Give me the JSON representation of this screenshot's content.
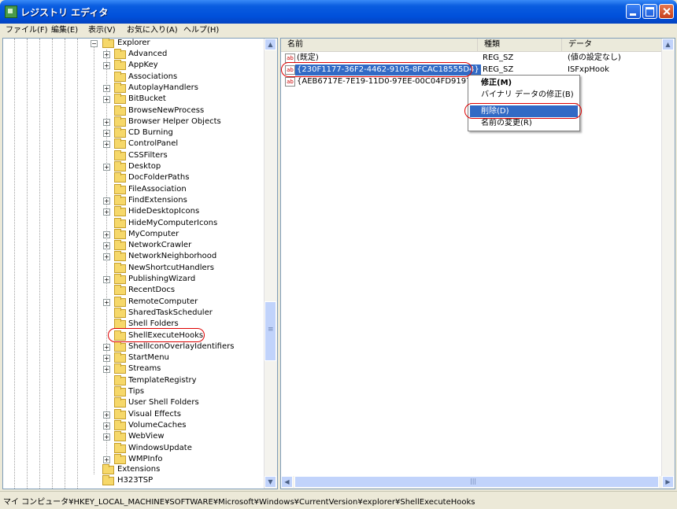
{
  "window": {
    "title": "レジストリ エディタ"
  },
  "menu": [
    {
      "label": "ファイル(F)"
    },
    {
      "label": "編集(E)"
    },
    {
      "label": "表示(V)"
    },
    {
      "label": "お気に入り(A)"
    },
    {
      "label": "ヘルプ(H)"
    }
  ],
  "tree": {
    "parent": "Explorer",
    "items": [
      {
        "label": "Advanced",
        "expandable": true
      },
      {
        "label": "AppKey",
        "expandable": true
      },
      {
        "label": "Associations",
        "expandable": false
      },
      {
        "label": "AutoplayHandlers",
        "expandable": true
      },
      {
        "label": "BitBucket",
        "expandable": true
      },
      {
        "label": "BrowseNewProcess",
        "expandable": false
      },
      {
        "label": "Browser Helper Objects",
        "expandable": true
      },
      {
        "label": "CD Burning",
        "expandable": true
      },
      {
        "label": "ControlPanel",
        "expandable": true
      },
      {
        "label": "CSSFilters",
        "expandable": false
      },
      {
        "label": "Desktop",
        "expandable": true
      },
      {
        "label": "DocFolderPaths",
        "expandable": false
      },
      {
        "label": "FileAssociation",
        "expandable": false
      },
      {
        "label": "FindExtensions",
        "expandable": true
      },
      {
        "label": "HideDesktopIcons",
        "expandable": true
      },
      {
        "label": "HideMyComputerIcons",
        "expandable": false
      },
      {
        "label": "MyComputer",
        "expandable": true
      },
      {
        "label": "NetworkCrawler",
        "expandable": true
      },
      {
        "label": "NetworkNeighborhood",
        "expandable": true
      },
      {
        "label": "NewShortcutHandlers",
        "expandable": false
      },
      {
        "label": "PublishingWizard",
        "expandable": true
      },
      {
        "label": "RecentDocs",
        "expandable": false
      },
      {
        "label": "RemoteComputer",
        "expandable": true
      },
      {
        "label": "SharedTaskScheduler",
        "expandable": false
      },
      {
        "label": "Shell Folders",
        "expandable": false
      },
      {
        "label": "ShellExecuteHooks",
        "expandable": false
      },
      {
        "label": "ShellIconOverlayIdentifiers",
        "expandable": true
      },
      {
        "label": "StartMenu",
        "expandable": true
      },
      {
        "label": "Streams",
        "expandable": true
      },
      {
        "label": "TemplateRegistry",
        "expandable": false
      },
      {
        "label": "Tips",
        "expandable": false
      },
      {
        "label": "User Shell Folders",
        "expandable": false
      },
      {
        "label": "Visual Effects",
        "expandable": true
      },
      {
        "label": "VolumeCaches",
        "expandable": true
      },
      {
        "label": "WebView",
        "expandable": true
      },
      {
        "label": "WindowsUpdate",
        "expandable": false
      },
      {
        "label": "WMPInfo",
        "expandable": true
      }
    ],
    "after": [
      {
        "label": "Extensions"
      },
      {
        "label": "H323TSP"
      }
    ]
  },
  "list": {
    "headers": {
      "name": "名前",
      "type": "種類",
      "data": "データ"
    },
    "rows": [
      {
        "name": "(既定)",
        "type": "REG_SZ",
        "data": "(値の設定なし)",
        "selected": false
      },
      {
        "name": "{230F1177-36F2-4462-9105-8FCAC18555D4}",
        "type": "REG_SZ",
        "data": "ISFxpHook",
        "selected": true
      },
      {
        "name": "{AEB6717E-7E19-11D0-97EE-00C04FD91972}",
        "type": "",
        "data": "",
        "selected": false
      }
    ]
  },
  "context_menu": {
    "modify": "修正(M)",
    "modify_binary": "バイナリ データの修正(B)",
    "delete": "削除(D)",
    "rename": "名前の変更(R)"
  },
  "status_bar": "マイ コンピュータ¥HKEY_LOCAL_MACHINE¥SOFTWARE¥Microsoft¥Windows¥CurrentVersion¥explorer¥ShellExecuteHooks",
  "scroll": {
    "up": "▲",
    "down": "▼",
    "left": "◀",
    "right": "▶",
    "grip": "≡",
    "hgrip": "|||"
  }
}
